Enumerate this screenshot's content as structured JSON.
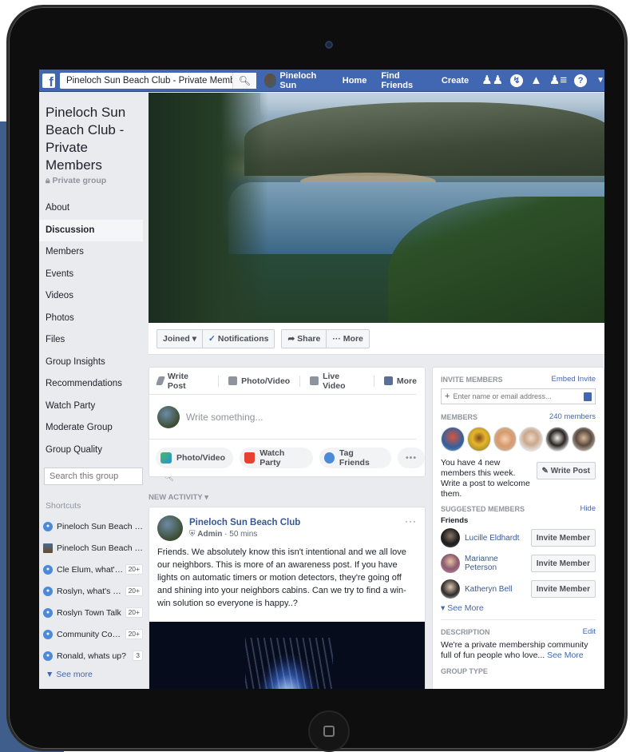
{
  "topbar": {
    "search_value": "Pineloch Sun Beach Club - Private Members",
    "user_name": "Pineloch Sun",
    "home": "Home",
    "find_friends": "Find Friends",
    "create": "Create"
  },
  "group": {
    "title": "Pineloch Sun Beach Club - Private Members",
    "privacy": "Private group"
  },
  "sidebar": {
    "items": [
      {
        "label": "About"
      },
      {
        "label": "Discussion"
      },
      {
        "label": "Members"
      },
      {
        "label": "Events"
      },
      {
        "label": "Videos"
      },
      {
        "label": "Photos"
      },
      {
        "label": "Files"
      },
      {
        "label": "Group Insights"
      },
      {
        "label": "Recommendations"
      },
      {
        "label": "Watch Party"
      },
      {
        "label": "Moderate Group"
      },
      {
        "label": "Group Quality"
      }
    ],
    "search_placeholder": "Search this group",
    "shortcuts_heading": "Shortcuts",
    "shortcuts": [
      {
        "label": "Pineloch Sun Beach Cl...",
        "badge": ""
      },
      {
        "label": "Pineloch Sun Beach Club",
        "badge": ""
      },
      {
        "label": "Cle Elum, what's up?",
        "badge": "20+"
      },
      {
        "label": "Roslyn, what's up?",
        "badge": "20+"
      },
      {
        "label": "Roslyn Town Talk",
        "badge": "20+"
      },
      {
        "label": "Community Conne...",
        "badge": "20+"
      },
      {
        "label": "Ronald, whats up?",
        "badge": "3"
      }
    ],
    "see_more": "See more"
  },
  "actions": {
    "joined": "Joined",
    "notifications": "Notifications",
    "share": "Share",
    "more": "More"
  },
  "composer": {
    "tabs": {
      "write_post": "Write Post",
      "photo_video": "Photo/Video",
      "live_video": "Live Video",
      "more": "More"
    },
    "placeholder": "Write something...",
    "pills": {
      "photo_video": "Photo/Video",
      "watch_party": "Watch Party",
      "tag_friends": "Tag Friends",
      "dots": "•••"
    }
  },
  "feed": {
    "new_activity": "NEW ACTIVITY",
    "post": {
      "author": "Pineloch Sun Beach Club",
      "role": "Admin",
      "time": "50 mins",
      "text": "Friends. We absolutely know this isn't intentional and we all love our neighbors. This is more of an awareness post. If you have lights on automatic timers or motion detectors, they're going off and shining into your neighbors cabins. Can we try to find a win-win solution so everyone is happy..?"
    }
  },
  "right": {
    "invite_heading": "INVITE MEMBERS",
    "embed_invite": "Embed Invite",
    "invite_placeholder": "Enter name or email address...",
    "members_heading": "MEMBERS",
    "members_count": "240 members",
    "new_members_text": "You have 4 new members this week. Write a post to welcome them.",
    "write_post": "Write Post",
    "suggested_heading": "SUGGESTED MEMBERS",
    "hide": "Hide",
    "friends_label": "Friends",
    "suggested": [
      {
        "name": "Lucille Eldhardt",
        "button": "Invite Member"
      },
      {
        "name": "Marianne Peterson",
        "button": "Invite Member"
      },
      {
        "name": "Katheryn Bell",
        "button": "Invite Member"
      }
    ],
    "see_more": "See More",
    "description_heading": "DESCRIPTION",
    "edit": "Edit",
    "description_text": "We're a private membership community full of fun people who love...",
    "description_see_more": "See More",
    "group_type_heading": "GROUP TYPE"
  }
}
